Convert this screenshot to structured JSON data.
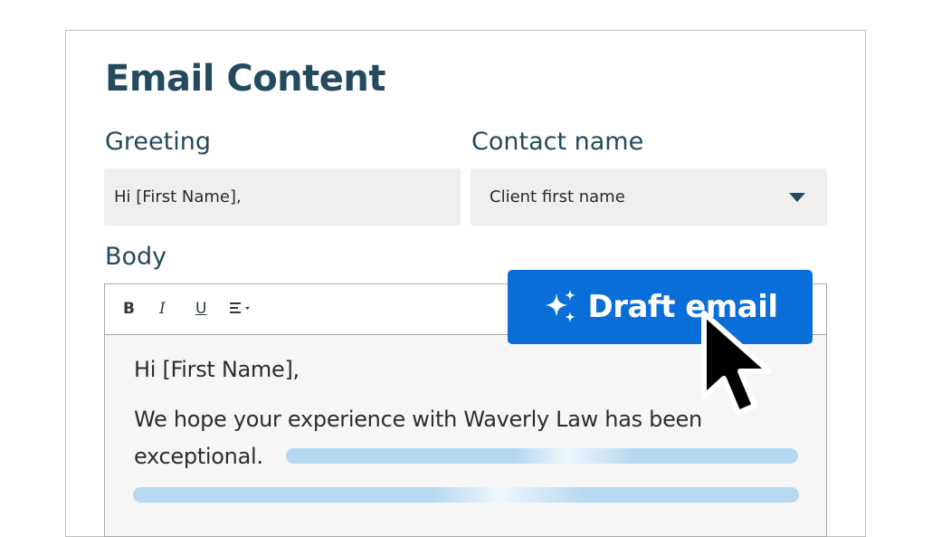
{
  "panel": {
    "title": "Email Content"
  },
  "greeting": {
    "label": "Greeting",
    "value": "Hi [First Name],"
  },
  "contact": {
    "label": "Contact name",
    "selected": "Client first name",
    "icon": "caret-down-icon"
  },
  "body": {
    "label": "Body",
    "toolbar": {
      "bold": "B",
      "italic": "I",
      "underline": "U",
      "align_icon": "align-left-icon"
    },
    "text_line1": "Hi [First Name],",
    "text_line2": "We hope your experience with Waverly Law has been",
    "text_line3": "exceptional."
  },
  "draft_button": {
    "label": "Draft email",
    "icon": "sparkle-icon",
    "color": "#0a6ed8"
  },
  "colors": {
    "heading": "#234a5e",
    "field_bg": "#f0efee",
    "shimmer": "#b6d9f1"
  }
}
